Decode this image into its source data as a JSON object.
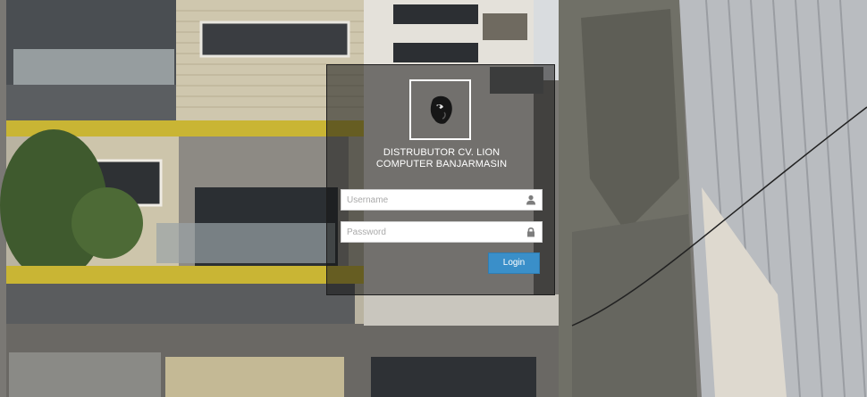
{
  "login": {
    "company_line1": "DISTRUBUTOR CV. LION",
    "company_line2": "COMPUTER BANJARMASIN",
    "username_placeholder": "Username",
    "password_placeholder": "Password",
    "login_label": "Login"
  },
  "icons": {
    "logo": "lion-head-icon",
    "username": "user-icon",
    "password": "lock-icon"
  },
  "colors": {
    "login_button": "#3a8fc9",
    "panel_overlay": "rgba(20,20,20,0.55)"
  }
}
